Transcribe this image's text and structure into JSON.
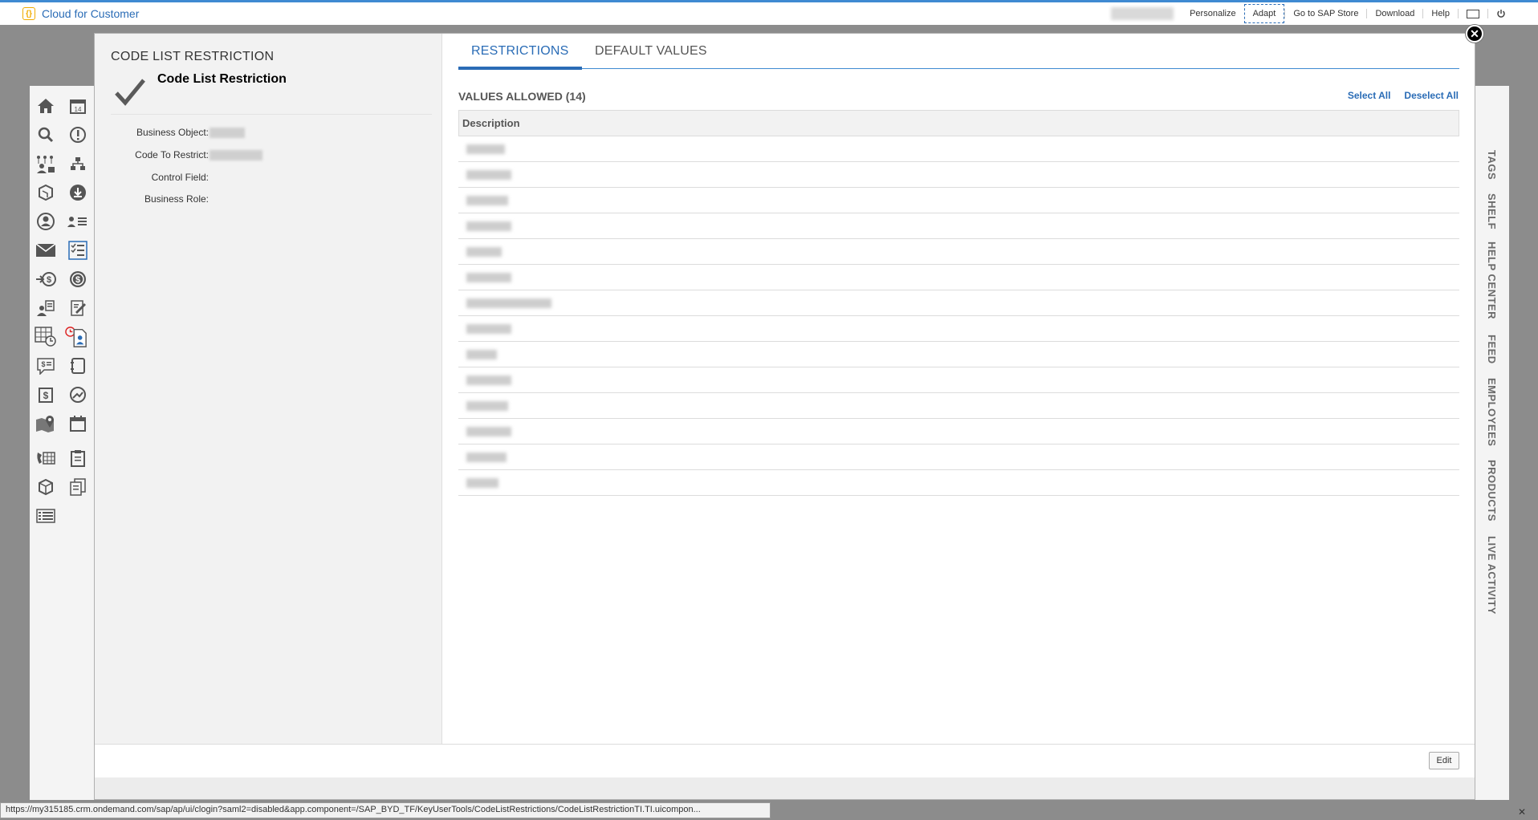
{
  "shell": {
    "app_title": "Cloud for Customer",
    "links": [
      "Personalize",
      "Adapt",
      "Go to SAP Store",
      "Download",
      "Help"
    ]
  },
  "left_nav_icons": [
    "home-icon",
    "calendar-14-icon",
    "search-icon",
    "alert-icon",
    "org-users-icon",
    "hierarchy-icon",
    "product-box-icon",
    "download-icon",
    "person-icon",
    "contact-list-icon",
    "mail-icon",
    "checklist-icon",
    "money-in-icon",
    "dollar-circle-icon",
    "user-doc-icon",
    "edit-doc-icon",
    "table-clock-icon",
    "timesheet-icon",
    "chat-dollar-icon",
    "notebook-icon",
    "invoice-dollar-icon",
    "globe-money-icon",
    "map-pin-icon",
    "calendar-icon",
    "phone-table-icon",
    "clipboard-icon",
    "cube-icon",
    "documents-icon",
    "list-icon"
  ],
  "right_panel": [
    "TAGS",
    "SHELF",
    "HELP CENTER",
    "FEED",
    "EMPLOYEES",
    "PRODUCTS",
    "LIVE ACTIVITY"
  ],
  "dialog": {
    "header_small": "CODE LIST RESTRICTION",
    "header_big": "Code List Restriction",
    "fields": [
      {
        "label": "Business Object:"
      },
      {
        "label": "Code To Restrict:"
      },
      {
        "label": "Control Field:"
      },
      {
        "label": "Business Role:"
      }
    ],
    "tabs": [
      "RESTRICTIONS",
      "DEFAULT VALUES"
    ],
    "section_title": "VALUES ALLOWED (14)",
    "select_all": "Select All",
    "deselect_all": "Deselect All",
    "table_header": "Description",
    "edit_label": "Edit"
  },
  "status_url": "https://my315185.crm.ondemand.com/sap/ap/ui/clogin?saml2=disabled&app.component=/SAP_BYD_TF/KeyUserTools/CodeListRestrictions/CodeListRestrictionTI.TI.uicompon..."
}
